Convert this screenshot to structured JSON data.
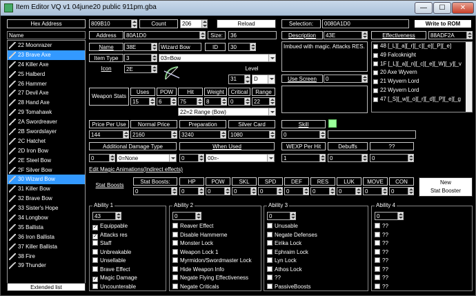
{
  "window": {
    "title": "Item Editor VQ v1 04june20 public 911pm.gba",
    "minimize": "—",
    "maximize": "☐",
    "close": "✕"
  },
  "left": {
    "hex_label": "Hex Address",
    "hex_value": "809B10",
    "name_header": "Name",
    "extended_button": "Extended list",
    "items": [
      "22 Moonrazer",
      "23 Brave Axe",
      "24 Killer Axe",
      "25 Halberd",
      "26 Hammer",
      "27 Devil Axe",
      "28 Hand Axe",
      "29 Tomahawk",
      "2A Swordreaver",
      "2B Swordslayer",
      "2C Hatchet",
      "2D Iron Bow",
      "2E Steel Bow",
      "2F Silver Bow",
      "30 Wizard Bow",
      "31 Killer Bow",
      "32 Brave Bow",
      "33 Sister's Hope",
      "34 Longbow",
      "35 Ballista",
      "36 Iron Ballista",
      "37 Killer Ballista",
      "38 Fire",
      "39 Thunder"
    ]
  },
  "top": {
    "count_label": "Count",
    "count_value": "206",
    "reload": "Reload",
    "selection_label": "Selection:",
    "selection_value": "0080A1D0",
    "write_rom": "Write to ROM"
  },
  "item": {
    "address_label": "Address",
    "address_value": "80A1D0",
    "size_label": "Size:",
    "size_value": "36",
    "name_label": "Name",
    "name_id": "38E",
    "name_text": "Wizard Bow",
    "id_label": "ID",
    "id_value": "30",
    "type_label": "Item Type",
    "type_value": "3",
    "type_name": "03=Bow",
    "icon_label": "Icon",
    "icon_value": "2E",
    "level_label": "Level",
    "level_value": "31",
    "level_rank": "D",
    "desc_label": "Description",
    "desc_value": "43E",
    "desc_text": "Imbued with magic. Attacks RES.",
    "usescreen_label": "Use Screen",
    "usescreen_value": "0",
    "eff_label": "Effectiveness",
    "eff_value": "88ADF2A"
  },
  "effectiveness": [
    "48 [_L][_a][_r][_c][_e][_P][_e]",
    "49 Falcoknight",
    "1F [_L][_a][_n][_c][_e][_W][_y][_v",
    "20 Axe Wyvern",
    "21 Wyvern Lord",
    "22 Wyvern Lord",
    "47 [_S][_w][_o][_r][_d][_P][_e][_g"
  ],
  "weapon_stats": {
    "label": "Weapon Stats",
    "headers": [
      "Uses",
      "POW",
      "Hit",
      "Weight",
      "Critical",
      "Range"
    ],
    "values": [
      "15",
      "6",
      "75",
      "8",
      "0",
      "22"
    ],
    "range_text": "22=2 Range (Bow)"
  },
  "prices": {
    "headers": [
      "Price Per Use",
      "Normal Price",
      "Preparation",
      "Silver Card"
    ],
    "values": [
      "144",
      "2160",
      "3240",
      "1080"
    ],
    "skill_label": "Skill",
    "skill_value": "0",
    "adt_label": "Additional Damage Type",
    "adt_value": "0",
    "adt_name": "0=None",
    "when_label": "When Used",
    "when_value": "0",
    "when_name": "00=-",
    "wexp_label": "WEXP Per Hit",
    "wexp_value": "1",
    "debuffs_label": "Debuffs",
    "debuffs_value": "0",
    "unk_label": "??",
    "unk_value": "0"
  },
  "magic_anim": "Edit Magic Animations(Indirect effects)",
  "stat_boosts": {
    "label": "Stat Boosts",
    "sublabel": "Stat Boosts:",
    "address": "0",
    "headers": [
      "HP",
      "POW",
      "SKL",
      "SPD",
      "DEF",
      "RES",
      "LUK",
      "MOVE",
      "CON"
    ],
    "values": [
      "0",
      "0",
      "0",
      "0",
      "0",
      "0",
      "0",
      "0",
      "0"
    ],
    "new_button": "New\nStat Booster"
  },
  "ability1": {
    "title": "Ability 1",
    "value": "43",
    "items": [
      {
        "label": "Equippable",
        "checked": true
      },
      {
        "label": "Attacks res",
        "checked": true
      },
      {
        "label": "Staff",
        "checked": false
      },
      {
        "label": "Unbreakable",
        "checked": false
      },
      {
        "label": "Unsellable",
        "checked": false
      },
      {
        "label": "Brave Effect",
        "checked": false
      },
      {
        "label": "Magic Damage",
        "checked": true
      },
      {
        "label": "Uncounterable",
        "checked": false
      }
    ]
  },
  "ability2": {
    "title": "Ability 2",
    "value": "0",
    "items": [
      {
        "label": "Reaver Effect",
        "checked": false
      },
      {
        "label": "Disable Hammerne",
        "checked": false
      },
      {
        "label": "Monster Lock",
        "checked": false
      },
      {
        "label": "Weapon Lock 1",
        "checked": false
      },
      {
        "label": "Myrmidon/Swordmaster Lock",
        "checked": false
      },
      {
        "label": "Hide Weapon Info",
        "checked": false
      },
      {
        "label": "Negate Flying Effectiveness",
        "checked": false
      },
      {
        "label": "Negate Criticals",
        "checked": false
      }
    ]
  },
  "ability3": {
    "title": "Ability 3",
    "value": "0",
    "items": [
      {
        "label": "Unusable",
        "checked": false
      },
      {
        "label": "Negate Defenses",
        "checked": false
      },
      {
        "label": "Eirika Lock",
        "checked": false
      },
      {
        "label": "Ephraim Lock",
        "checked": false
      },
      {
        "label": "Lyn Lock",
        "checked": false
      },
      {
        "label": "Athos Lock",
        "checked": false
      },
      {
        "label": "??",
        "checked": false
      },
      {
        "label": "PassiveBoosts",
        "checked": false
      }
    ]
  },
  "ability4": {
    "title": "Ability 4",
    "value": "0",
    "items": [
      {
        "label": "??",
        "checked": false
      },
      {
        "label": "??",
        "checked": false
      },
      {
        "label": "??",
        "checked": false
      },
      {
        "label": "??",
        "checked": false
      },
      {
        "label": "??",
        "checked": false
      },
      {
        "label": "??",
        "checked": false
      },
      {
        "label": "??",
        "checked": false
      },
      {
        "label": "??",
        "checked": false
      }
    ]
  },
  "selected_index": 14
}
